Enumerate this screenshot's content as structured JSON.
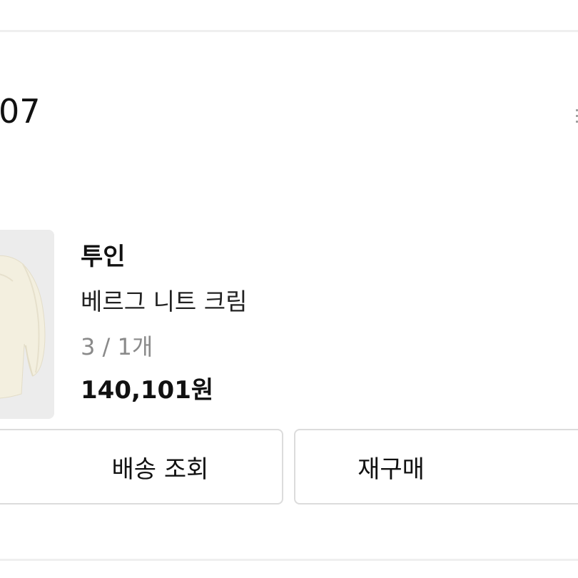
{
  "order": {
    "date_fragment": "07"
  },
  "product": {
    "brand": "투인",
    "name": "베르그 니트 크림",
    "option": "3 / 1개",
    "price": "140,101원",
    "thumbnail_alt": "cream knit cardigan"
  },
  "actions": {
    "track_label": "배송 조회",
    "reorder_label": "재구매"
  },
  "colors": {
    "background": "#ffffff",
    "divider": "#efefef",
    "thumbnail_bg": "#ececec",
    "knit": "#f3efdf",
    "muted_text": "#8a8a8a",
    "button_border": "#dcdcdc"
  }
}
